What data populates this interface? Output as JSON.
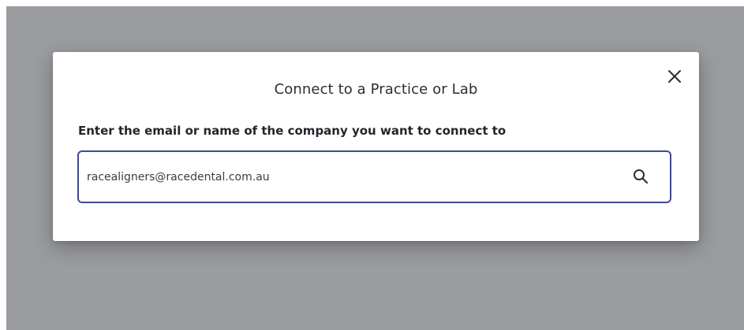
{
  "dialog": {
    "title": "Connect to a Practice or Lab",
    "label": "Enter the email or name of the company you want to connect to",
    "search": {
      "value": "racealigners@racedental.com.au",
      "icon": "search-icon"
    },
    "close_icon": "close-icon"
  },
  "colors": {
    "overlay": "#9a9c9f",
    "input_border": "#3e4a93",
    "caret": "#d8204a"
  }
}
